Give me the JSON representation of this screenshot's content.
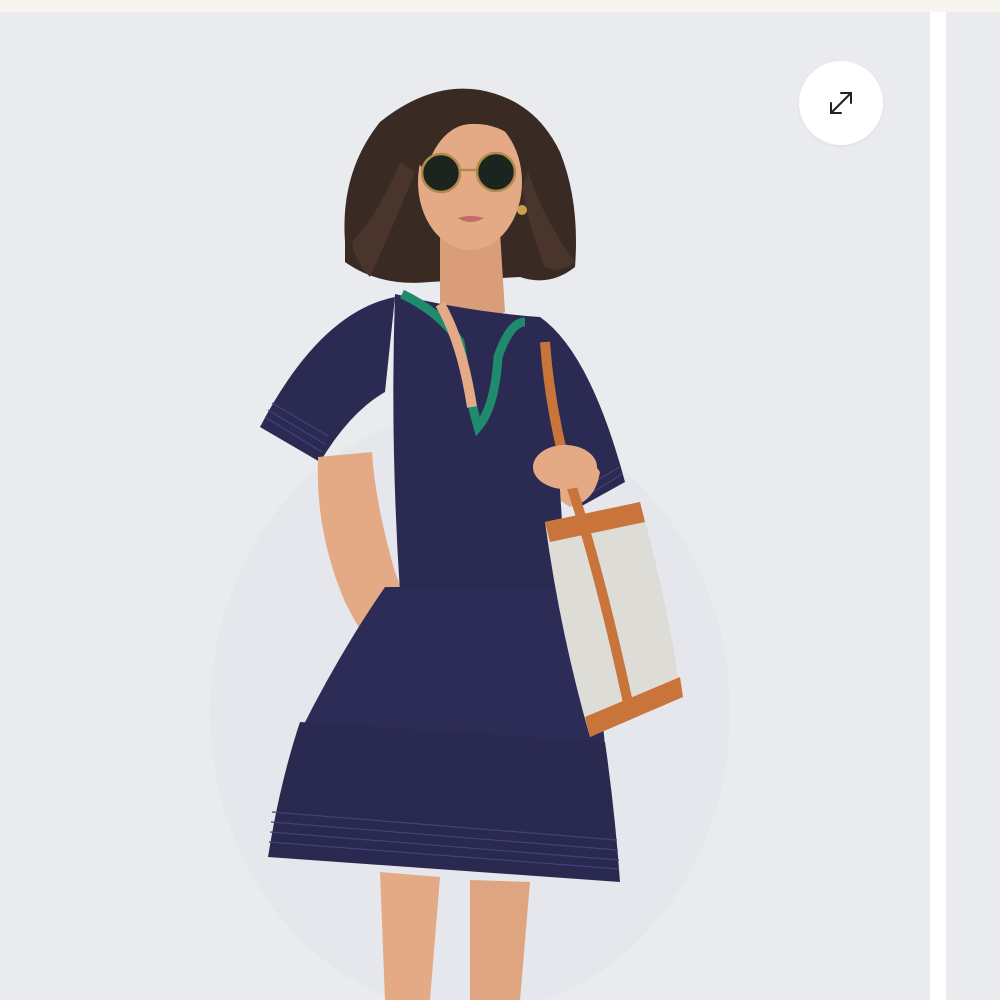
{
  "gallery": {
    "expand_button": {
      "icon": "expand-arrows-icon"
    }
  },
  "colors": {
    "top_strip": "#f8f5ef",
    "image_background": "#e9ebef",
    "dress": "#2b2a52",
    "embroidery": "#1f8a6c",
    "bag_canvas": "#dedcd6",
    "bag_leather": "#c9743a",
    "skin": "#e3aa85",
    "hair": "#3a2a24"
  }
}
